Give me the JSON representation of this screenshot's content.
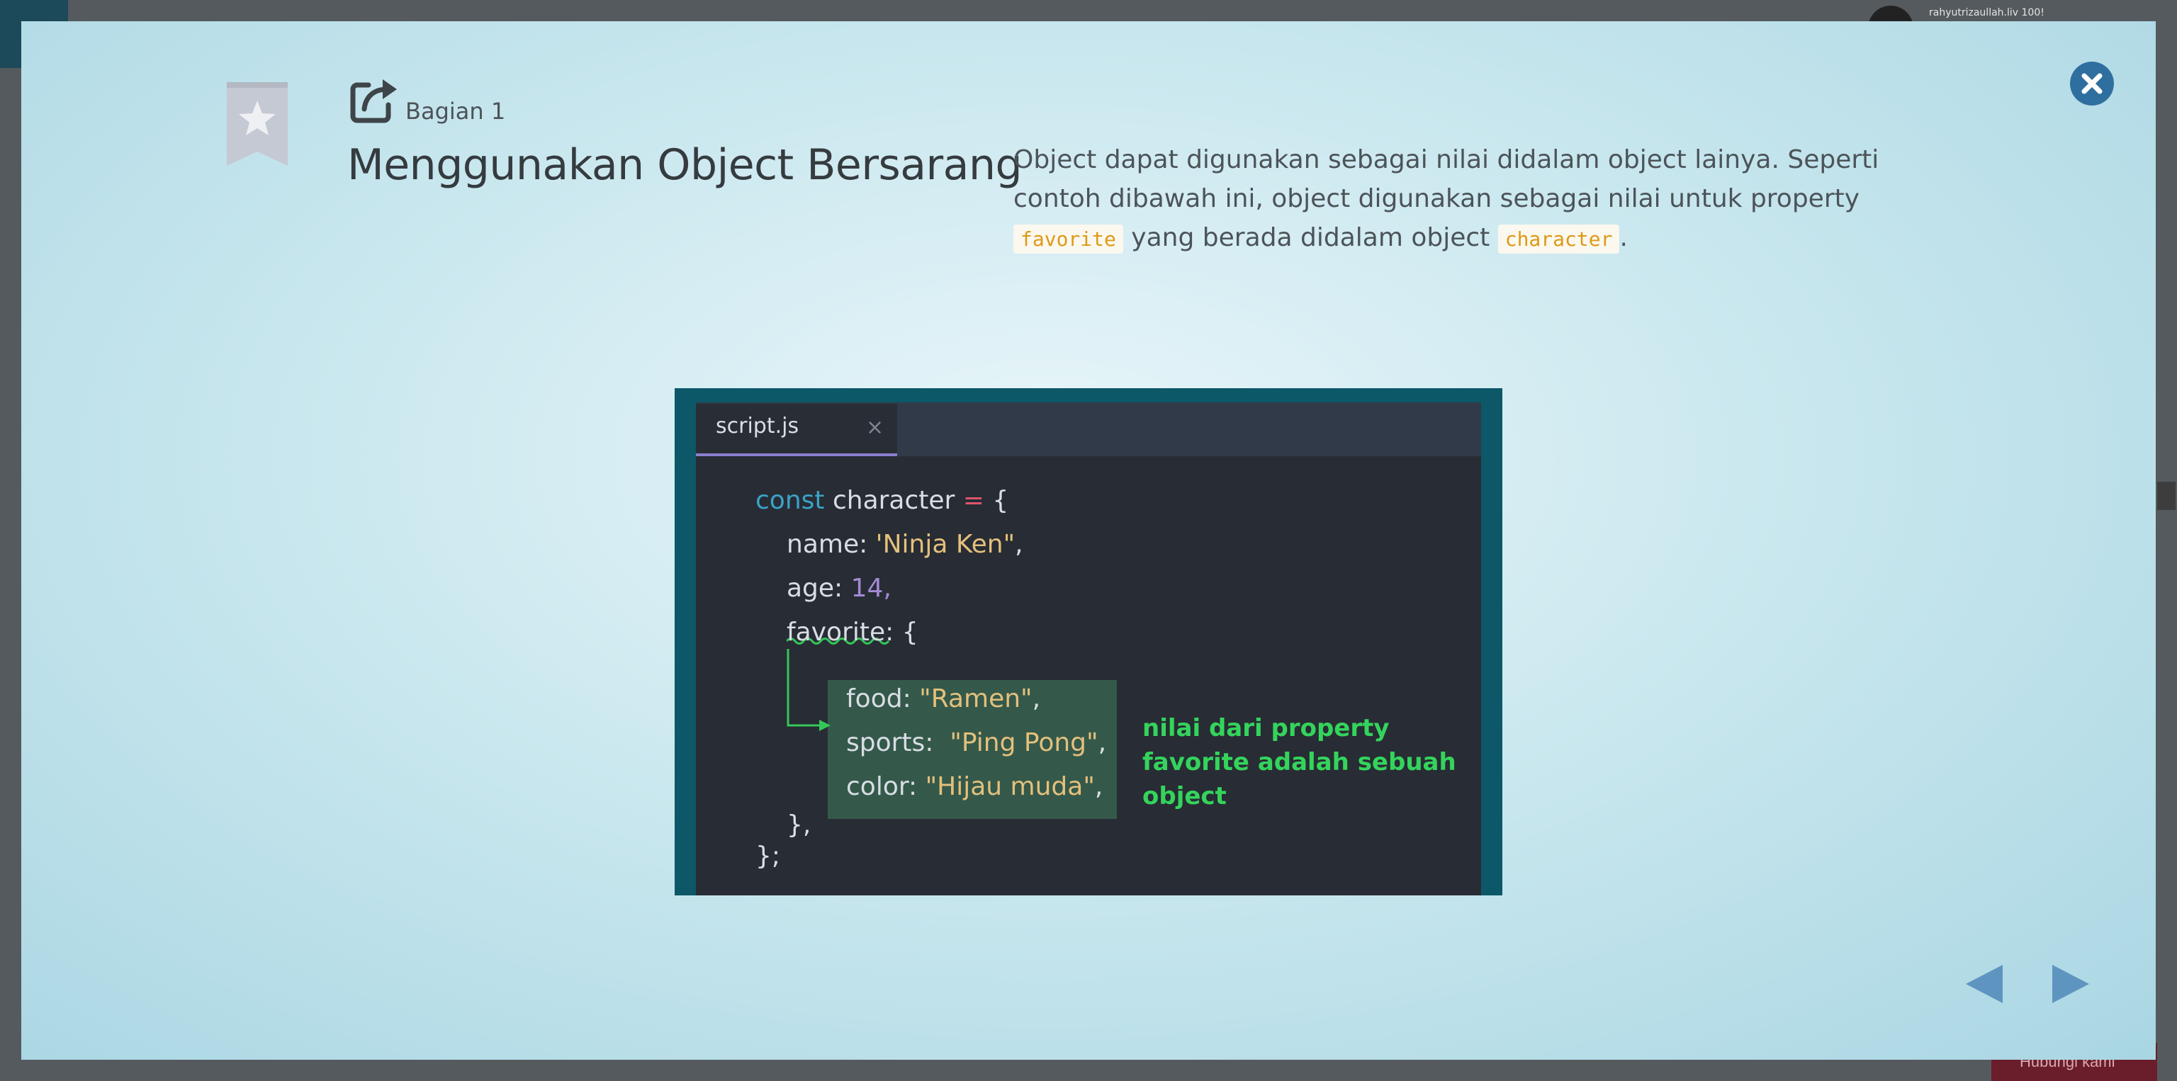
{
  "background_app": {
    "username": "rahyutrizaullah.liv 100!",
    "bottom_button_label": "Hubungi kami"
  },
  "modal": {
    "section_label": "Bagian 1",
    "title": "Menggunakan Object Bersarang",
    "description": {
      "text_1": "Object dapat digunakan sebagai nilai didalam object lainya. Seperti contoh dibawah ini, object digunakan sebagai nilai untuk property ",
      "code_1": "favorite",
      "text_2": " yang berada didalam object ",
      "code_2": "character",
      "text_3": "."
    },
    "icons": {
      "bookmark": "bookmark-star-icon",
      "open": "external-link-icon",
      "close": "close-circle-icon",
      "prev": "triangle-left-icon",
      "next": "triangle-right-icon"
    },
    "colors": {
      "accent": "#2f6f9f",
      "nav_arrow": "#5e95c0",
      "code_highlight": "#dd9a16"
    }
  },
  "code_image": {
    "tab_name": "script.js",
    "tab_close": "×",
    "lines": {
      "l1_kw": "const",
      "l1_name": " character ",
      "l1_op": "=",
      "l1_brace": " {",
      "l2_key": "name: ",
      "l2_val": "'Ninja Ken\"",
      "l2_comma": ",",
      "l3_key": "age: ",
      "l3_val": "14,",
      "l4_key": "favorite",
      "l4_rest": ": {",
      "l5_key": "food: ",
      "l5_val": "\"Ramen\"",
      "l5_comma": ",",
      "l6_key": "sports:  ",
      "l6_val": "\"Ping Pong\"",
      "l6_comma": ",",
      "l7_key": "color: ",
      "l7_val": "\"Hijau muda\"",
      "l7_comma": ",",
      "l8": "},",
      "l9": "};"
    },
    "annotation": "nilai dari property favorite adalah sebuah object"
  }
}
